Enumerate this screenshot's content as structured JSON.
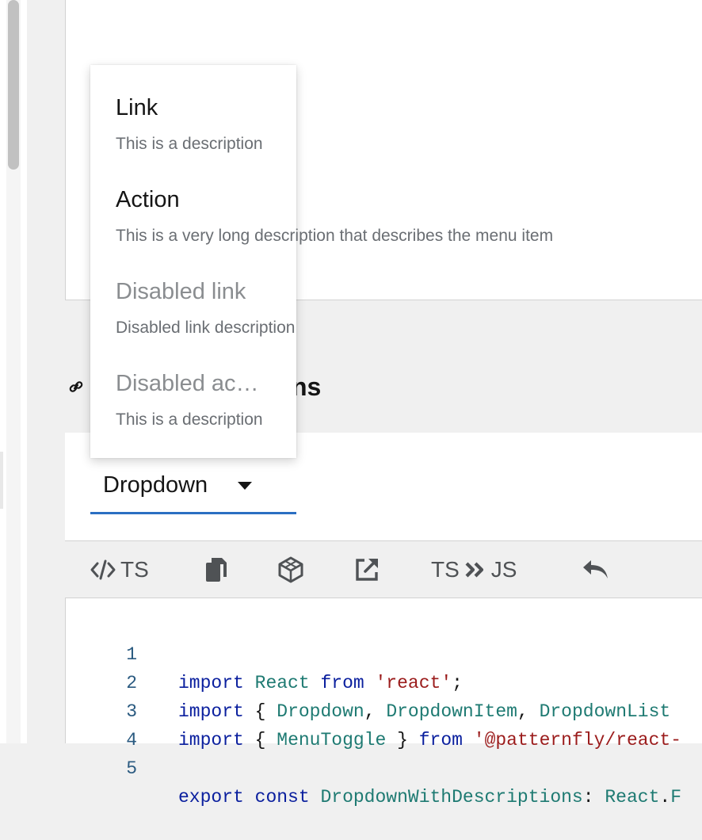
{
  "menu": {
    "items": [
      {
        "title": "Link",
        "description": "This is a description",
        "disabled": false
      },
      {
        "title": "Action",
        "description": "This is a very long description that describes the menu item",
        "disabled": false
      },
      {
        "title": "Disabled link",
        "description": "Disabled link description",
        "disabled": true
      },
      {
        "title": "Disabled ac…",
        "description": "This is a description",
        "disabled": true
      }
    ]
  },
  "section": {
    "heading_visible": "ns",
    "link_icon": "link-icon"
  },
  "toggle": {
    "label": "Dropdown",
    "icon": "caret-down-icon",
    "accent": "#2b6fc2"
  },
  "toolbar": {
    "ts_label": "TS",
    "convert_from": "TS",
    "convert_to": "JS",
    "icons": [
      "code-icon",
      "copy-icon",
      "codesandbox-icon",
      "external-link-icon",
      "angle-double-right-icon",
      "undo-icon"
    ]
  },
  "code": {
    "lines": [
      {
        "number": "1",
        "text": "import React from 'react';"
      },
      {
        "number": "2",
        "text": "import { Dropdown, DropdownItem, DropdownList"
      },
      {
        "number": "3",
        "text": "import { MenuToggle } from '@patternfly/react-"
      },
      {
        "number": "4",
        "text": ""
      },
      {
        "number": "5",
        "text": "export const DropdownWithDescriptions: React.F"
      }
    ]
  }
}
